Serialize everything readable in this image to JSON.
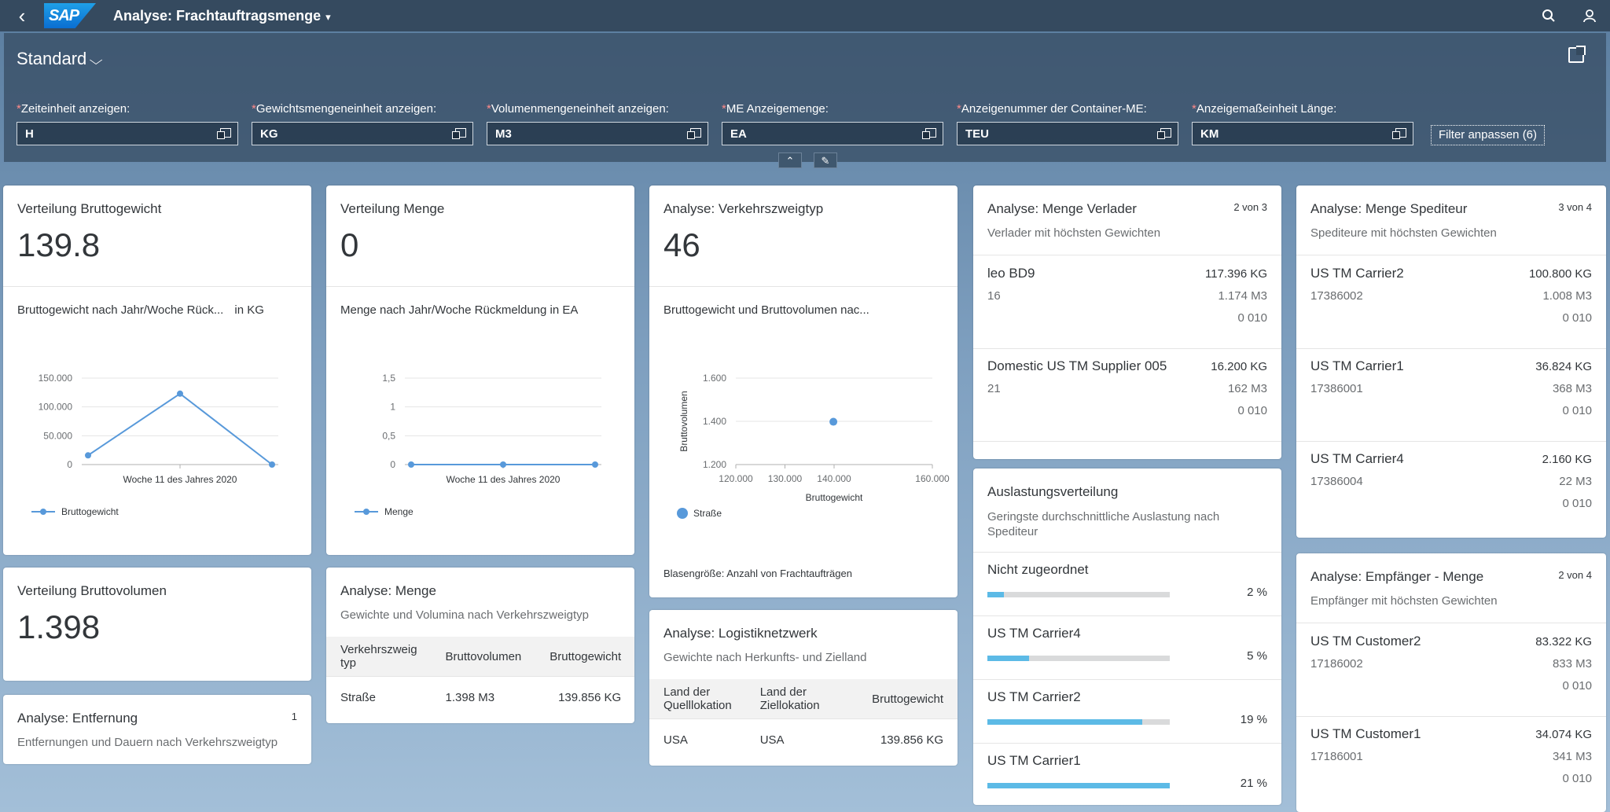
{
  "shell": {
    "back": "‹",
    "logo": "SAP",
    "title": "Analyse: Frachtauftragsmenge",
    "caret": "▾"
  },
  "filterbar": {
    "variant": "Standard",
    "filters": [
      {
        "label": "Zeiteinheit anzeigen:",
        "value": "H"
      },
      {
        "label": "Gewichtsmengeneinheit anzeigen:",
        "value": "KG"
      },
      {
        "label": "Volumenmengeneinheit anzeigen:",
        "value": "M3"
      },
      {
        "label": "ME Anzeigemenge:",
        "value": "EA"
      },
      {
        "label": "Anzeigenummer der Container-ME:",
        "value": "TEU"
      },
      {
        "label": "Anzeigemaßeinheit Länge:",
        "value": "KM"
      }
    ],
    "adapt_filters": "Filter anpassen (6)"
  },
  "cards": {
    "brutto": {
      "title": "Verteilung Bruttogewicht",
      "kpi": "139.8",
      "chart_title": "Bruttogewicht nach Jahr/Woche Rück...",
      "unit": "in KG",
      "legend": "Bruttogewicht"
    },
    "menge": {
      "title": "Verteilung Menge",
      "kpi": "0",
      "chart_title": "Menge nach Jahr/Woche Rückmeldung in EA",
      "legend": "Menge"
    },
    "verkehr": {
      "title": "Analyse: Verkehrszweigtyp",
      "kpi": "46",
      "chart_title": "Bruttogewicht und Bruttovolumen nac...",
      "legend": "Straße",
      "footnote": "Blasengröße: Anzahl von Frachtaufträgen"
    },
    "verlader": {
      "title": "Analyse: Menge Verlader",
      "count": "2 von 3",
      "subtitle": "Verlader mit höchsten Gewichten",
      "items": [
        {
          "name": "leo BD9",
          "sub": "16",
          "v1": "117.396 KG",
          "v2": "1.174 M3",
          "v3": "0 010"
        },
        {
          "name": "Domestic US TM Supplier 005",
          "sub": "21",
          "v1": "16.200 KG",
          "v2": "162 M3",
          "v3": "0 010"
        }
      ]
    },
    "spediteur": {
      "title": "Analyse: Menge Spediteur",
      "count": "3 von 4",
      "subtitle": "Spediteure mit höchsten Gewichten",
      "items": [
        {
          "name": "US TM Carrier2",
          "sub": "17386002",
          "v1": "100.800 KG",
          "v2": "1.008 M3",
          "v3": "0 010"
        },
        {
          "name": "US TM Carrier1",
          "sub": "17386001",
          "v1": "36.824 KG",
          "v2": "368 M3",
          "v3": "0 010"
        },
        {
          "name": "US TM Carrier4",
          "sub": "17386004",
          "v1": "2.160 KG",
          "v2": "22 M3",
          "v3": "0 010"
        }
      ]
    },
    "volumen": {
      "title": "Verteilung Bruttovolumen",
      "kpi": "1.398"
    },
    "entfernung": {
      "title": "Analyse: Entfernung",
      "count": "1",
      "subtitle": "Entfernungen und Dauern nach Verkehrszweigtyp"
    },
    "analyse_menge": {
      "title": "Analyse: Menge",
      "subtitle": "Gewichte und Volumina nach Verkehrszweigtyp",
      "headers": [
        "Verkehrszweig typ",
        "Bruttovolumen",
        "Bruttogewicht"
      ],
      "rows": [
        [
          "Straße",
          "1.398 M3",
          "139.856 KG"
        ]
      ]
    },
    "logistik": {
      "title": "Analyse: Logistiknetzwerk",
      "subtitle": "Gewichte nach Herkunfts- und Zielland",
      "headers": [
        "Land der Quelllokation",
        "Land der Ziellokation",
        "Bruttogewicht"
      ],
      "rows": [
        [
          "USA",
          "USA",
          "139.856 KG"
        ]
      ]
    },
    "auslastung": {
      "title": "Auslastungsverteilung",
      "subtitle": "Geringste durchschnittliche Auslastung nach Spediteur",
      "items": [
        {
          "name": "Nicht zugeordnet",
          "pct": "2 %",
          "fill": 0.09
        },
        {
          "name": "US TM Carrier4",
          "pct": "5 %",
          "fill": 0.23
        },
        {
          "name": "US TM Carrier2",
          "pct": "19 %",
          "fill": 0.85
        },
        {
          "name": "US TM Carrier1",
          "pct": "21 %",
          "fill": 1.0
        }
      ]
    },
    "empfaenger": {
      "title": "Analyse: Empfänger - Menge",
      "count": "2 von 4",
      "subtitle": "Empfänger mit höchsten Gewichten",
      "items": [
        {
          "name": "US TM Customer2",
          "sub": "17186002",
          "v1": "83.322 KG",
          "v2": "833 M3",
          "v3": "0 010"
        },
        {
          "name": "US TM Customer1",
          "sub": "17186001",
          "v1": "34.074 KG",
          "v2": "341 M3",
          "v3": "0 010"
        }
      ]
    }
  },
  "chart_data": [
    {
      "type": "line",
      "title": "Bruttogewicht nach Jahr/Woche Rück...",
      "x_label_shown": "Woche 11 des Jahres 2020",
      "yticks": [
        "150.000",
        "100.000",
        "50.000",
        "0"
      ],
      "ylim": [
        0,
        150000
      ],
      "series": [
        {
          "name": "Bruttogewicht",
          "values": [
            16000,
            123000,
            0
          ]
        }
      ],
      "color": "#5899da"
    },
    {
      "type": "line",
      "title": "Menge nach Jahr/Woche Rückmeldung in EA",
      "x_label_shown": "Woche 11 des Jahres 2020",
      "yticks": [
        "1,5",
        "1",
        "0,5",
        "0"
      ],
      "ylim": [
        0,
        1.5
      ],
      "series": [
        {
          "name": "Menge",
          "values": [
            0,
            0,
            0
          ]
        }
      ],
      "color": "#5899da"
    },
    {
      "type": "scatter",
      "title": "Bruttogewicht und Bruttovolumen nac...",
      "xlabel": "Bruttogewicht",
      "ylabel": "Bruttovolumen",
      "xticks": [
        "120.000",
        "130.000",
        "140.000",
        "160.000"
      ],
      "yticks": [
        "1.600",
        "1.400",
        "1.200"
      ],
      "xlim": [
        120000,
        160000
      ],
      "ylim": [
        1200,
        1600
      ],
      "series": [
        {
          "name": "Straße",
          "points": [
            [
              139856,
              1398
            ]
          ]
        }
      ],
      "color": "#5899da"
    }
  ]
}
